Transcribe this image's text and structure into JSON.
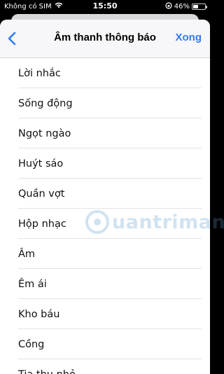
{
  "status_bar": {
    "carrier": "Không có SIM",
    "time": "15:50",
    "battery_label": "46%",
    "battery_level": 0.46
  },
  "nav": {
    "title": "Âm thanh thông báo",
    "done_label": "Xong",
    "accent_color": "#2f7cf6"
  },
  "sounds": [
    "Lời nhắc",
    "Sống động",
    "Ngọt ngào",
    "Huýt sáo",
    "Quần vợt",
    "Hộp nhạc",
    "Âm",
    "Êm ái",
    "Kho báu",
    "Cồng",
    "Tia thu nhỏ"
  ],
  "watermark": {
    "text": "uantrimang"
  }
}
